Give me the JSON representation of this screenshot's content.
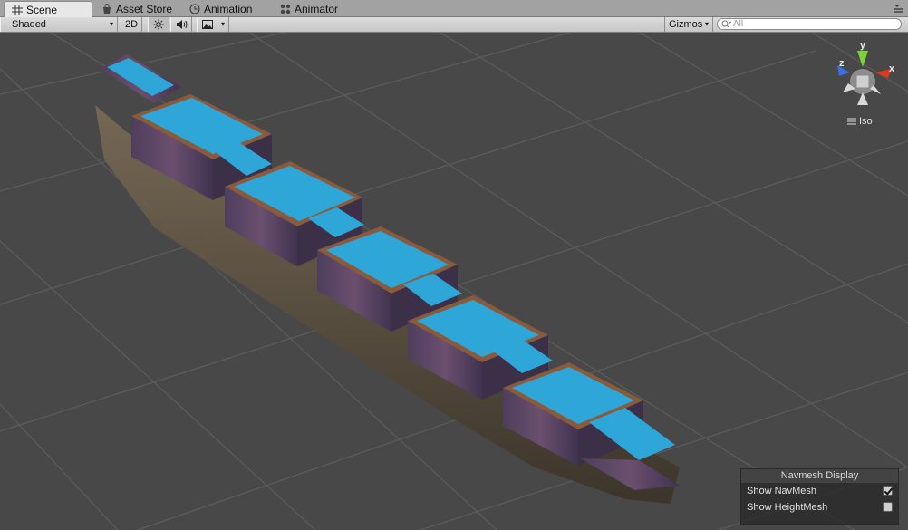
{
  "tabs": [
    {
      "label": "Scene",
      "icon": "grid-icon",
      "active": true
    },
    {
      "label": "Asset Store",
      "icon": "bag-icon",
      "active": false
    },
    {
      "label": "Animation",
      "icon": "clock-icon",
      "active": false
    },
    {
      "label": "Animator",
      "icon": "nodes-icon",
      "active": false
    }
  ],
  "toolbar": {
    "shading_mode": "Shaded",
    "mode_2d_label": "2D",
    "gizmos_label": "Gizmos",
    "search_placeholder": "All"
  },
  "gizmo": {
    "x_label": "x",
    "y_label": "y",
    "z_label": "z",
    "projection_label": "Iso"
  },
  "navmesh_panel": {
    "title": "Navmesh Display",
    "show_navmesh_label": "Show NavMesh",
    "show_navmesh_checked": true,
    "show_heightmesh_label": "Show HeightMesh",
    "show_heightmesh_checked": false
  },
  "colors": {
    "axis_x": "#e03a1e",
    "axis_y": "#7ad23c",
    "axis_z": "#3b6fe0",
    "navmesh": "#2fa6d8"
  }
}
